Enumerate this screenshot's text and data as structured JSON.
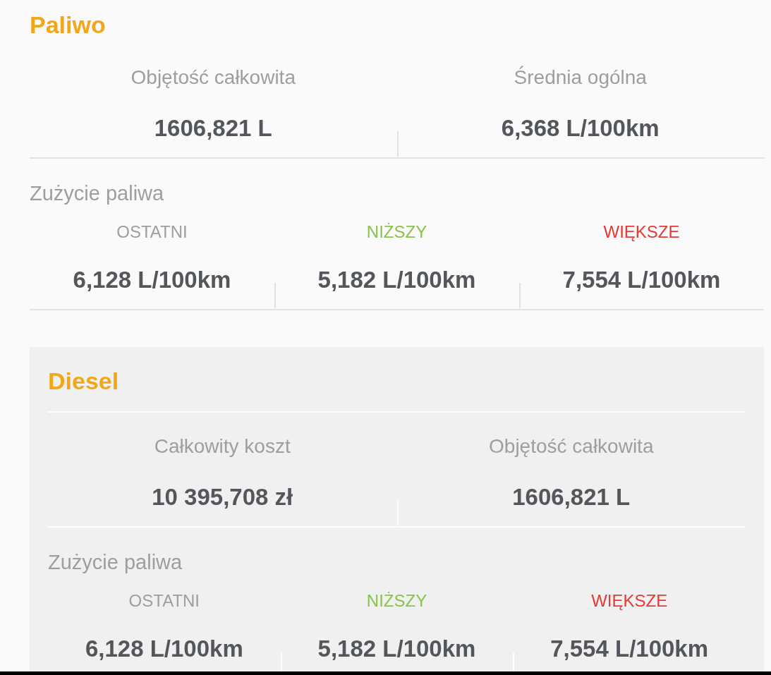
{
  "sections": [
    {
      "kind": "overview",
      "title": "Paliwo",
      "stats": [
        {
          "label": "Objętość całkowita",
          "value": "1606,821 L"
        },
        {
          "label": "Średnia ogólna",
          "value": "6,368 L/100km"
        }
      ],
      "consumption": {
        "title": "Zużycie paliwa",
        "items": [
          {
            "label": "OSTATNI",
            "color": "#9e9e9e",
            "value": "6,128 L/100km"
          },
          {
            "label": "NIŻSZY",
            "color": "#8bc34a",
            "value": "5,182 L/100km"
          },
          {
            "label": "WIĘKSZE",
            "color": "#e53935",
            "value": "7,554 L/100km"
          }
        ]
      }
    },
    {
      "kind": "fuel",
      "title": "Diesel",
      "stats": [
        {
          "label": "Całkowity koszt",
          "value": "10 395,708 zł"
        },
        {
          "label": "Objętość całkowita",
          "value": "1606,821 L"
        }
      ],
      "consumption": {
        "title": "Zużycie paliwa",
        "items": [
          {
            "label": "OSTATNI",
            "color": "#9e9e9e",
            "value": "6,128 L/100km"
          },
          {
            "label": "NIŻSZY",
            "color": "#8bc34a",
            "value": "5,182 L/100km"
          },
          {
            "label": "WIĘKSZE",
            "color": "#e53935",
            "value": "7,554 L/100km"
          }
        ]
      }
    }
  ]
}
